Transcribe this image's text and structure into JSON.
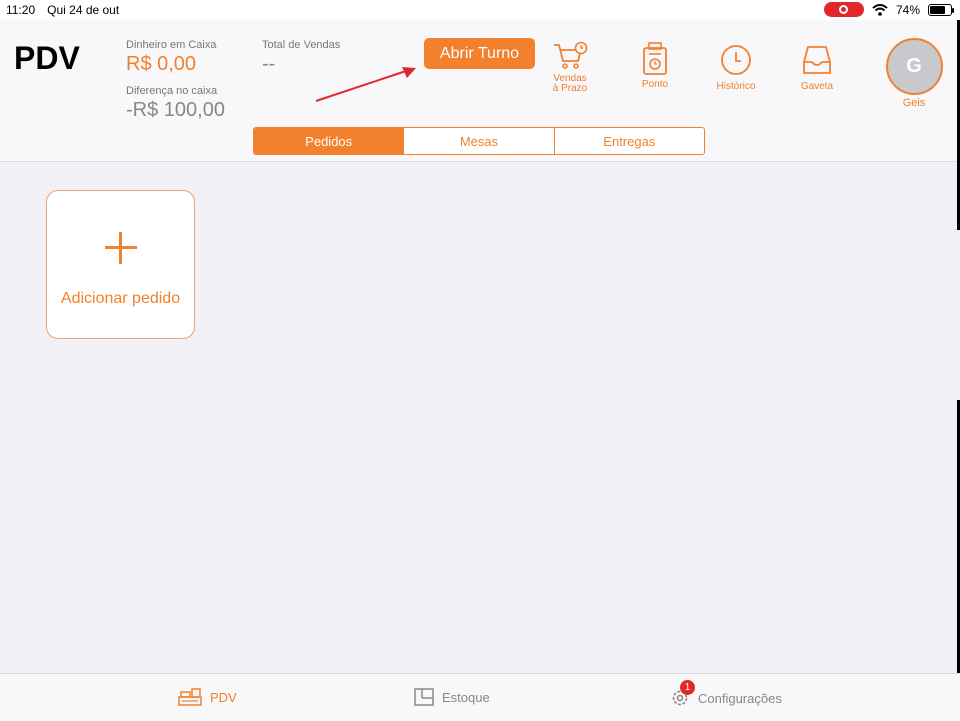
{
  "status_bar": {
    "time": "11:20",
    "date": "Qui 24 de out",
    "battery": "74%",
    "battery_level": 0.74
  },
  "header": {
    "title": "PDV",
    "cash_label": "Dinheiro em Caixa",
    "cash_value": "R$ 0,00",
    "diff_label": "Diferença no caixa",
    "diff_value": "-R$ 100,00",
    "sales_label": "Total de Vendas",
    "sales_value": "--",
    "open_shift_label": "Abrir Turno"
  },
  "tools": [
    {
      "icon": "cart-clock-icon",
      "label_line1": "Vendas",
      "label_line2": "à Prazo"
    },
    {
      "icon": "time-clock-icon",
      "label": "Ponto"
    },
    {
      "icon": "clock-icon",
      "label": "Histórico"
    },
    {
      "icon": "drawer-icon",
      "label": "Gaveta"
    }
  ],
  "user": {
    "initial": "G",
    "name": "Geis"
  },
  "tabs": [
    {
      "label": "Pedidos",
      "active": true
    },
    {
      "label": "Mesas",
      "active": false
    },
    {
      "label": "Entregas",
      "active": false
    }
  ],
  "add_order": {
    "label": "Adicionar pedido"
  },
  "bottom_tabs": [
    {
      "icon": "register-icon",
      "label": "PDV"
    },
    {
      "icon": "box-icon",
      "label": "Estoque"
    },
    {
      "icon": "gear-icon",
      "label": "Configurações",
      "badge": "1"
    }
  ],
  "colors": {
    "accent": "#f2802d",
    "badge": "#e0282a",
    "annotation_arrow": "#e0282a"
  }
}
